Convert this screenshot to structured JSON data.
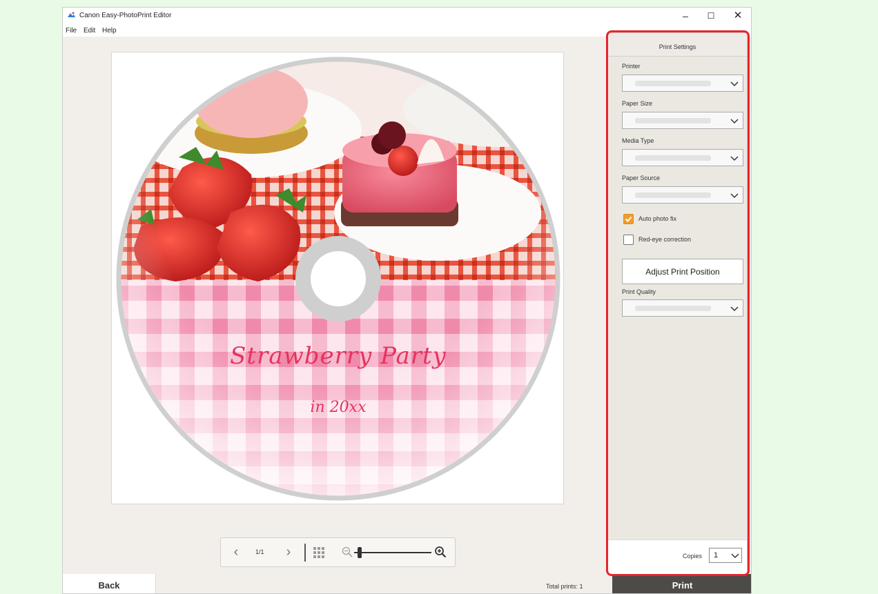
{
  "window": {
    "title": "Canon Easy-PhotoPrint Editor",
    "minimize": "–",
    "maximize": "☐",
    "close": "✕"
  },
  "menu": [
    "File",
    "Edit",
    "Help"
  ],
  "disc": {
    "title": "Strawberry Party",
    "subtitle": "in 20xx"
  },
  "toolbar": {
    "page": "1/1",
    "prev": "‹",
    "next": "›",
    "zoom_level": 0.05
  },
  "panel": {
    "header": "Print Settings",
    "printer_label": "Printer",
    "paper_size_label": "Paper Size",
    "media_type_label": "Media Type",
    "paper_source_label": "Paper Source",
    "auto_photo_fix_label": "Auto photo fix",
    "auto_photo_fix_checked": true,
    "red_eye_label": "Red-eye correction",
    "red_eye_checked": false,
    "adjust_button": "Adjust Print Position",
    "print_quality_label": "Print Quality",
    "copies_label": "Copies",
    "copies_value": "1"
  },
  "footer": {
    "back": "Back",
    "total_prints": "Total prints: 1",
    "print": "Print"
  },
  "colors": {
    "accent_checkbox": "#f39b2a",
    "highlight": "#e8242b",
    "print_button": "#4d4b48",
    "disc_text": "#e3355e"
  }
}
